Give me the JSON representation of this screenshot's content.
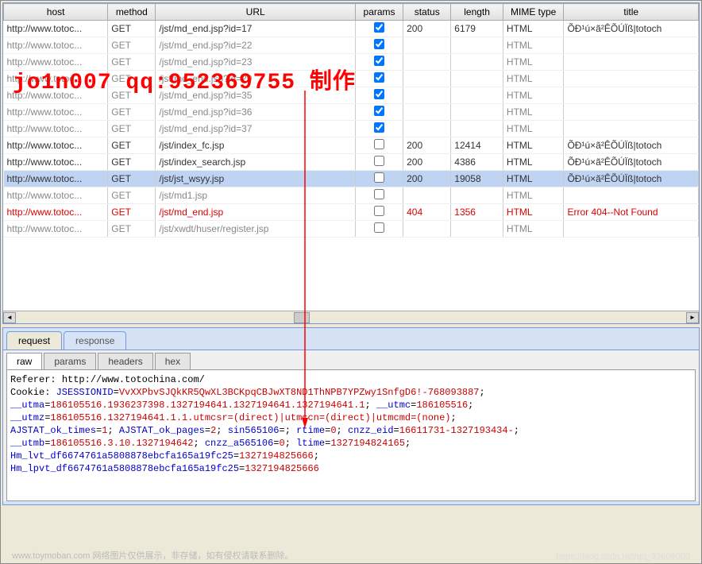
{
  "headers": {
    "host": "host",
    "method": "method",
    "url": "URL",
    "params": "params",
    "status": "status",
    "length": "length",
    "mime": "MIME type",
    "title": "title"
  },
  "rows": [
    {
      "host": "http://www.totoc...",
      "method": "GET",
      "url": "/jst/md_end.jsp?id=17",
      "params": true,
      "status": "200",
      "length": "6179",
      "mime": "HTML",
      "title": "ÕÐ¹ú×ã²ÊÕÚÏß|totoch",
      "cls": ""
    },
    {
      "host": "http://www.totoc...",
      "method": "GET",
      "url": "/jst/md_end.jsp?id=22",
      "params": true,
      "status": "",
      "length": "",
      "mime": "HTML",
      "title": "",
      "cls": "gray"
    },
    {
      "host": "http://www.totoc...",
      "method": "GET",
      "url": "/jst/md_end.jsp?id=23",
      "params": true,
      "status": "",
      "length": "",
      "mime": "HTML",
      "title": "",
      "cls": "gray"
    },
    {
      "host": "http://www.totoc...",
      "method": "GET",
      "url": "/jst/md_end.jsp?id=29",
      "params": true,
      "status": "",
      "length": "",
      "mime": "HTML",
      "title": "",
      "cls": "gray"
    },
    {
      "host": "http://www.totoc...",
      "method": "GET",
      "url": "/jst/md_end.jsp?id=35",
      "params": true,
      "status": "",
      "length": "",
      "mime": "HTML",
      "title": "",
      "cls": "gray"
    },
    {
      "host": "http://www.totoc...",
      "method": "GET",
      "url": "/jst/md_end.jsp?id=36",
      "params": true,
      "status": "",
      "length": "",
      "mime": "HTML",
      "title": "",
      "cls": "gray"
    },
    {
      "host": "http://www.totoc...",
      "method": "GET",
      "url": "/jst/md_end.jsp?id=37",
      "params": true,
      "status": "",
      "length": "",
      "mime": "HTML",
      "title": "",
      "cls": "gray"
    },
    {
      "host": "http://www.totoc...",
      "method": "GET",
      "url": "/jst/index_fc.jsp",
      "params": false,
      "status": "200",
      "length": "12414",
      "mime": "HTML",
      "title": "ÕÐ¹ú×ã²ÊÕÚÏß|totoch",
      "cls": ""
    },
    {
      "host": "http://www.totoc...",
      "method": "GET",
      "url": "/jst/index_search.jsp",
      "params": false,
      "status": "200",
      "length": "4386",
      "mime": "HTML",
      "title": "ÕÐ¹ú×ã²ÊÕÚÏß|totoch",
      "cls": ""
    },
    {
      "host": "http://www.totoc...",
      "method": "GET",
      "url": "/jst/jst_wsyy.jsp",
      "params": false,
      "status": "200",
      "length": "19058",
      "mime": "HTML",
      "title": "ÕÐ¹ú×ã²ÊÕÚÏß|totoch",
      "cls": "sel"
    },
    {
      "host": "http://www.totoc...",
      "method": "GET",
      "url": "/jst/md1.jsp",
      "params": false,
      "status": "",
      "length": "",
      "mime": "HTML",
      "title": "",
      "cls": "gray"
    },
    {
      "host": "http://www.totoc...",
      "method": "GET",
      "url": "/jst/md_end.jsp",
      "params": false,
      "status": "404",
      "length": "1356",
      "mime": "HTML",
      "title": "Error 404--Not Found",
      "cls": "red"
    },
    {
      "host": "http://www.totoc...",
      "method": "GET",
      "url": "/jst/xwdt/huser/register.jsp",
      "params": false,
      "status": "",
      "length": "",
      "mime": "HTML",
      "title": "",
      "cls": "gray"
    }
  ],
  "tabs": {
    "request": "request",
    "response": "response"
  },
  "subtabs": {
    "raw": "raw",
    "params": "params",
    "headers": "headers",
    "hex": "hex"
  },
  "raw": {
    "referer_k": "Referer: ",
    "referer_v": "http://www.totochina.com/",
    "cookie_k": "Cookie: ",
    "jsess_k": "JSESSIONID",
    "jsess_v": "VvXXPbvSJQkKR5QwXL3BCKpqCBJwXT8ND1ThNPB7YPZwy1SnfgD6!-768093887",
    "utma_k": "__utma",
    "utma_v": "186105516.1936237398.1327194641.1327194641.1327194641.1",
    "utmc_k": "__utmc",
    "utmc_v": "186105516",
    "utmz_k": "__utmz",
    "utmz_v": "186105516.1327194641.1.1.utmcsr=(direct)|utmccn=(direct)|utmcmd=(none)",
    "ajok_k": "AJSTAT_ok_times",
    "ajok_v": "1",
    "ajop_k": "AJSTAT_ok_pages",
    "ajop_v": "2",
    "sin_k": "sin565106",
    "sin_v": "",
    "rtime_k": "rtime",
    "rtime_v": "0",
    "cnzz_k": "cnzz_eid",
    "cnzz_v": "16611731-1327193434-",
    "utmb_k": "__utmb",
    "utmb_v": "186105516.3.10.1327194642",
    "cnzza_k": "cnzz_a565106",
    "cnzza_v": "0",
    "ltime_k": "ltime",
    "ltime_v": "1327194824165",
    "hmlvt_k": "Hm_lvt_df6674761a5808878ebcfa165a19fc25",
    "hmlvt_v": "1327194825666",
    "hmlpvt_k": "Hm_lpvt_df6674761a5808878ebcfa165a19fc25",
    "hmlpvt_v": "1327194825666"
  },
  "overlay": "jo1n007 qq:952369755 制作",
  "watermark_left": "www.toymoban.com  网络图片仅供展示，非存储，如有侵权请联系删除。",
  "watermark_right": "https://blog.csdn.net/qq_33608000"
}
